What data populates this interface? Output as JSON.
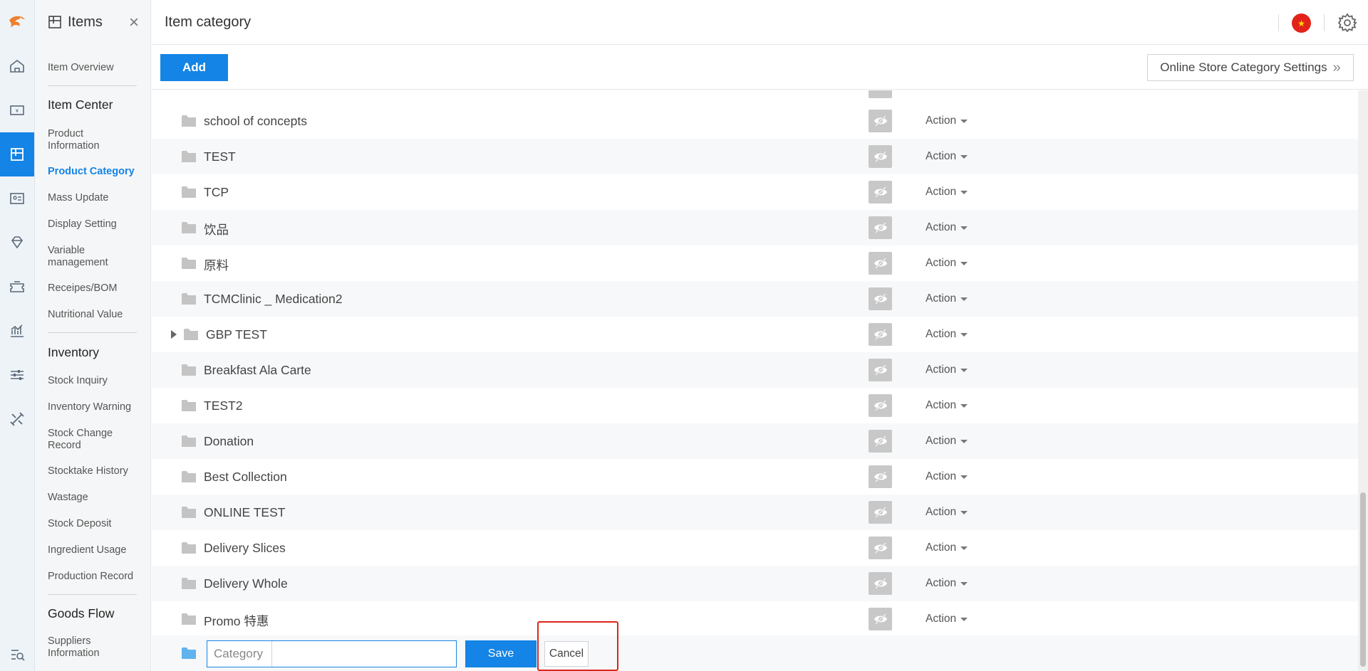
{
  "sidebar": {
    "title": "Items",
    "close_label": "×",
    "item_overview": "Item Overview",
    "sections": [
      {
        "label": "Item Center",
        "items": [
          "Product Information",
          "Product Category",
          "Mass Update",
          "Display Setting",
          "Variable management",
          "Receipes/BOM",
          "Nutritional Value"
        ]
      },
      {
        "label": "Inventory",
        "items": [
          "Stock Inquiry",
          "Inventory Warning",
          "Stock Change Record",
          "Stocktake History",
          "Wastage",
          "Stock Deposit",
          "Ingredient Usage",
          "Production Record"
        ]
      },
      {
        "label": "Goods Flow",
        "items": [
          "Suppliers Information"
        ]
      }
    ],
    "active_item": "Product Category"
  },
  "rail": {
    "icons": [
      "home-icon",
      "cash-register-icon",
      "item-box-icon",
      "member-card-icon",
      "diamond-icon",
      "coupon-icon",
      "chart-icon",
      "settings-sliders-icon",
      "tools-icon"
    ],
    "active_icon": "item-box-icon",
    "accent": "#1484e6"
  },
  "header": {
    "title": "Item category",
    "language_flag": "★"
  },
  "toolbar": {
    "add_label": "Add",
    "online_store_label": "Online Store Category Settings",
    "online_store_chevron": "»"
  },
  "categories": [
    {
      "name": "school of concepts",
      "expandable": false
    },
    {
      "name": "TEST",
      "expandable": false
    },
    {
      "name": "TCP",
      "expandable": false
    },
    {
      "name": "饮品",
      "expandable": false
    },
    {
      "name": "原料",
      "expandable": false
    },
    {
      "name": "TCMClinic _ Medication2",
      "expandable": false
    },
    {
      "name": "GBP TEST",
      "expandable": true
    },
    {
      "name": "Breakfast Ala Carte",
      "expandable": false
    },
    {
      "name": "TEST2",
      "expandable": false
    },
    {
      "name": "Donation",
      "expandable": false
    },
    {
      "name": "Best Collection",
      "expandable": false
    },
    {
      "name": "ONLINE TEST",
      "expandable": false
    },
    {
      "name": "Delivery Slices",
      "expandable": false
    },
    {
      "name": "Delivery Whole",
      "expandable": false
    },
    {
      "name": "Promo 特惠",
      "expandable": false
    }
  ],
  "row_action_label": "Action",
  "new_category": {
    "label": "Category",
    "value": "",
    "save_label": "Save",
    "cancel_label": "Cancel"
  }
}
